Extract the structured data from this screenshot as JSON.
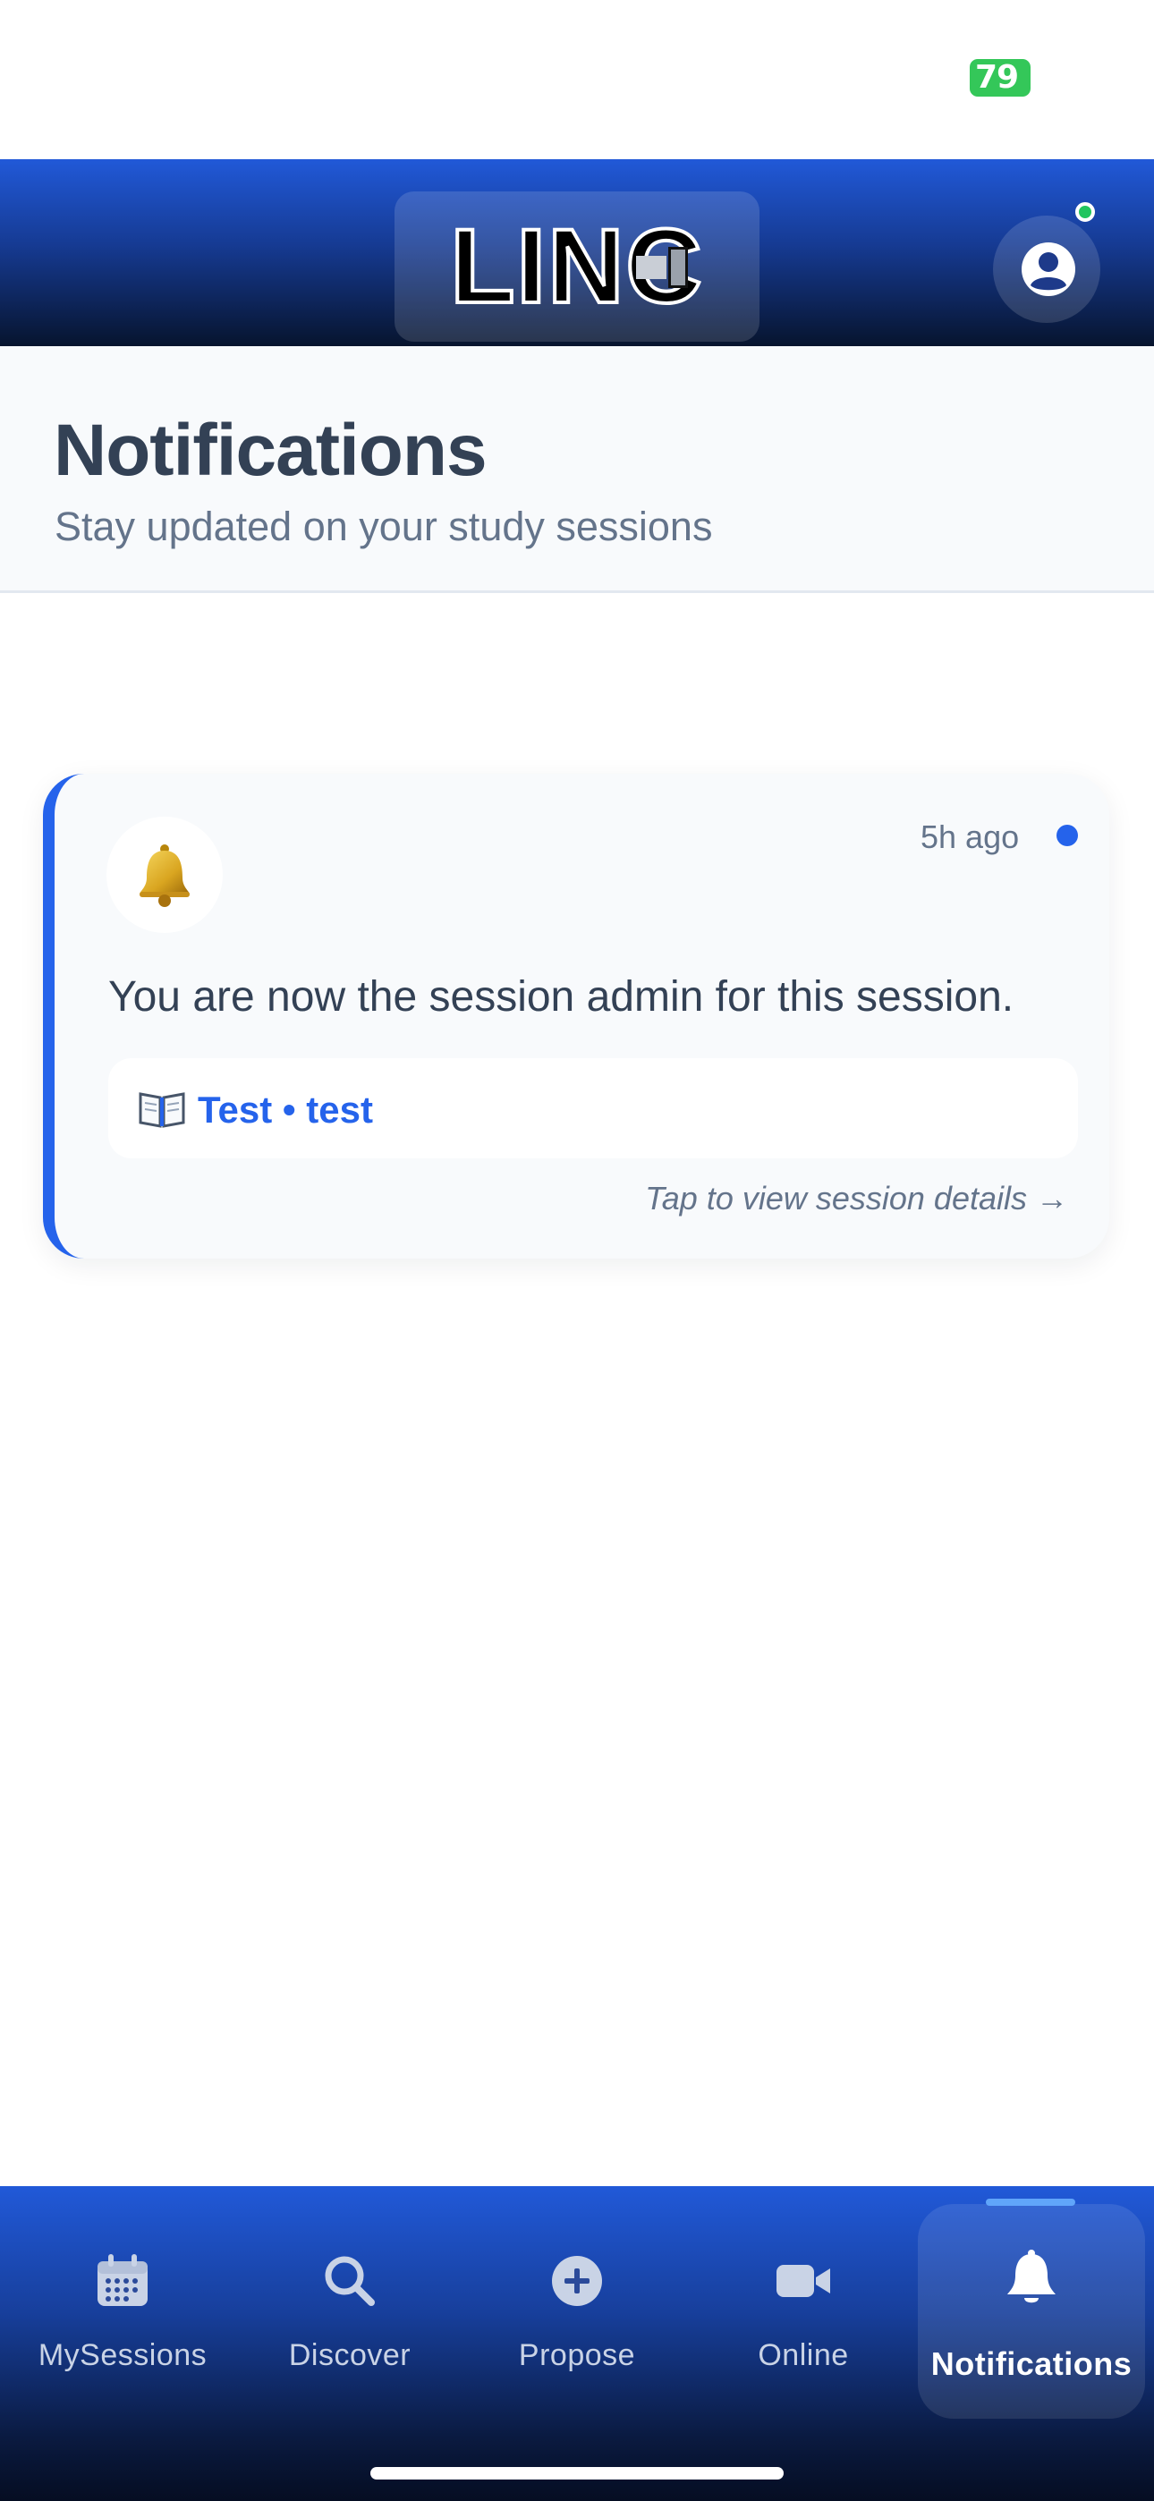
{
  "status_bar": {
    "battery": "79"
  },
  "header": {
    "logo": "LINC",
    "profile_icon": "user-circle-icon"
  },
  "page": {
    "title": "Notifications",
    "subtitle": "Stay updated on your study sessions"
  },
  "notifications": [
    {
      "icon": "bell-emoji",
      "time": "5h ago",
      "unread": true,
      "message": "You are now the session admin for this session.",
      "session_icon": "open-book-emoji",
      "session": "Test • test",
      "hint": "Tap to view session details →"
    }
  ],
  "bottom_nav": [
    {
      "label": "MySessions",
      "icon": "calendar-icon"
    },
    {
      "label": "Discover",
      "icon": "search-icon"
    },
    {
      "label": "Propose",
      "icon": "plus-circle-icon"
    },
    {
      "label": "Online",
      "icon": "video-camera-icon"
    },
    {
      "label": "Notifications",
      "icon": "bell-icon",
      "active": true
    }
  ],
  "colors": {
    "accent": "#2563eb",
    "online": "#22c55e",
    "battery": "#34c759"
  }
}
